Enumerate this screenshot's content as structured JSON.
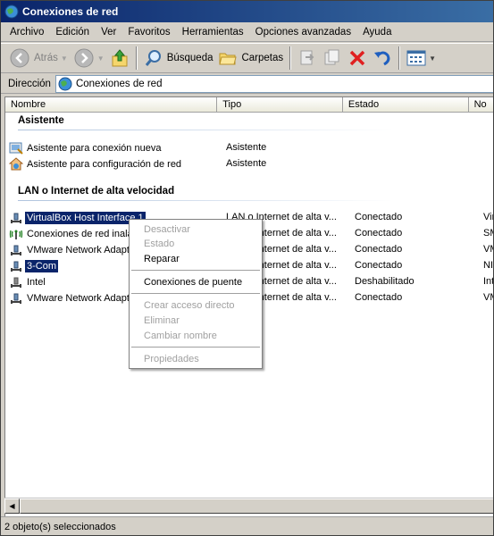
{
  "window": {
    "title": "Conexiones de red"
  },
  "menubar": {
    "items": [
      "Archivo",
      "Edición",
      "Ver",
      "Favoritos",
      "Herramientas",
      "Opciones avanzadas",
      "Ayuda"
    ]
  },
  "toolbar": {
    "back_label": "Atrás",
    "search_label": "Búsqueda",
    "folders_label": "Carpetas"
  },
  "address": {
    "label": "Dirección",
    "value": "Conexiones de red"
  },
  "columns": [
    "Nombre",
    "Tipo",
    "Estado",
    "No"
  ],
  "groups": [
    {
      "title": "Asistente",
      "rows": [
        {
          "name": "Asistente para conexión nueva",
          "type": "Asistente",
          "state": "",
          "extra": "",
          "icon": "wizard-icon",
          "selected": false
        },
        {
          "name": "Asistente para configuración de red",
          "type": "Asistente",
          "state": "",
          "extra": "",
          "icon": "network-wizard-icon",
          "selected": false
        }
      ]
    },
    {
      "title": "LAN o Internet de alta velocidad",
      "rows": [
        {
          "name": "VirtualBox Host Interface 1",
          "type": "LAN o Internet de alta v...",
          "state": "Conectado",
          "extra": "Virt",
          "icon": "lan-connection-icon",
          "selected": true
        },
        {
          "name": "Conexiones de red inalá",
          "type": "LAN o Internet de alta v...",
          "state": "Conectado",
          "extra": "SMC",
          "icon": "wireless-connection-icon",
          "selected": false
        },
        {
          "name": "VMware Network Adapt",
          "type": "LAN o Internet de alta v...",
          "state": "Conectado",
          "extra": "VMw",
          "icon": "lan-connection-icon",
          "selected": false
        },
        {
          "name": "3-Com",
          "type": "LAN o Internet de alta v...",
          "state": "Conectado",
          "extra": "NIC",
          "icon": "lan-connection-icon",
          "selected": true
        },
        {
          "name": "Intel",
          "type": "LAN o Internet de alta v...",
          "state": "Deshabilitado",
          "extra": "Inte",
          "icon": "lan-connection-icon",
          "selected": false
        },
        {
          "name": "VMware Network Adapt",
          "type": "LAN o Internet de alta v...",
          "state": "Conectado",
          "extra": "VMw",
          "icon": "lan-connection-icon",
          "selected": false
        }
      ]
    }
  ],
  "context_menu": {
    "items": [
      {
        "label": "Desactivar",
        "enabled": false
      },
      {
        "label": "Estado",
        "enabled": false
      },
      {
        "label": "Reparar",
        "enabled": true
      },
      {
        "label": "Conexiones de puente",
        "enabled": true
      },
      {
        "label": "Crear acceso directo",
        "enabled": false
      },
      {
        "label": "Eliminar",
        "enabled": false
      },
      {
        "label": "Cambiar nombre",
        "enabled": false
      },
      {
        "label": "Propiedades",
        "enabled": false
      }
    ]
  },
  "status": {
    "text": "2 objeto(s) seleccionados"
  },
  "colors": {
    "selection": "#0a246a",
    "titlebar": "#0a246a"
  }
}
